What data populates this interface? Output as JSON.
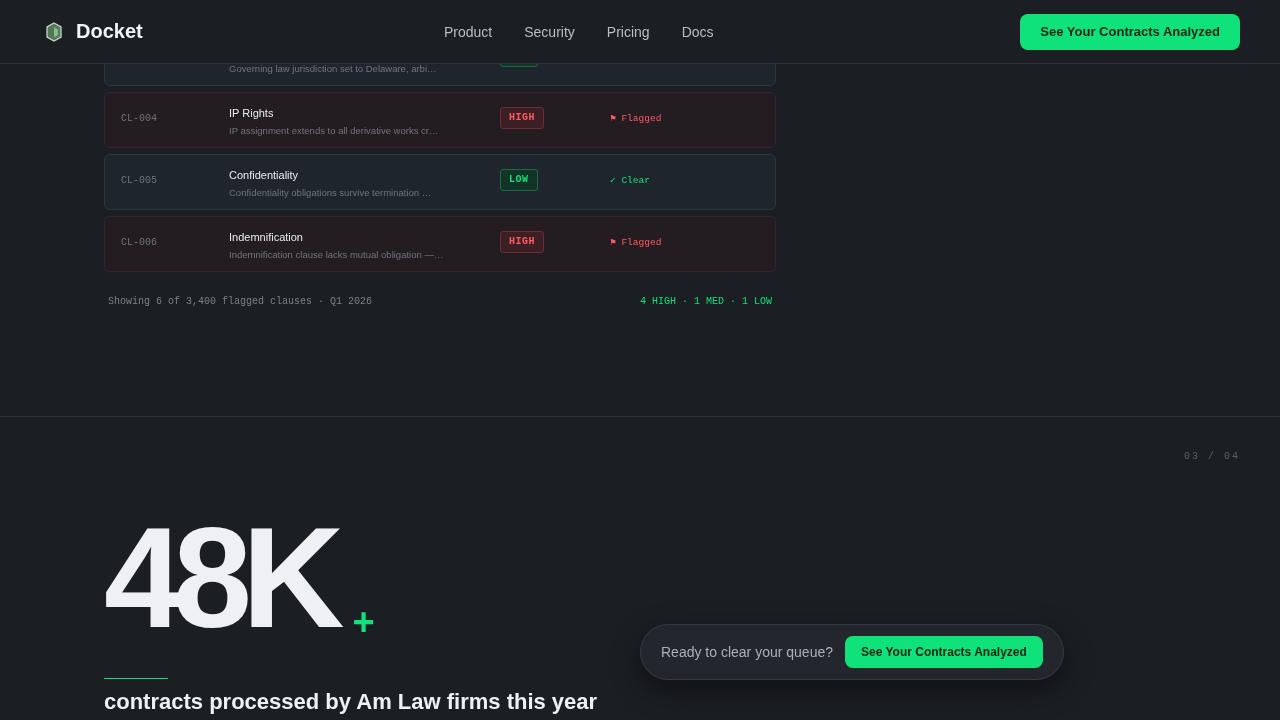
{
  "header": {
    "brand": "Docket",
    "nav": [
      {
        "label": "Product"
      },
      {
        "label": "Security"
      },
      {
        "label": "Pricing"
      },
      {
        "label": "Docs"
      }
    ],
    "cta": "See Your Contracts Analyzed"
  },
  "clauses": [
    {
      "description": "Governing law jurisdiction set to Delaware, arbi…",
      "flagged": false
    },
    {
      "id": "CL-004",
      "title": "IP Rights",
      "description": "IP assignment extends to all derivative works cr…",
      "flagged": true,
      "badge": "HIGH",
      "status": "⚑ Flagged"
    },
    {
      "id": "CL-005",
      "title": "Confidentiality",
      "description": "Confidentiality obligations survive termination …",
      "flagged": false,
      "badge": "LOW",
      "status": "✓ Clear"
    },
    {
      "id": "CL-006",
      "title": "Indemnification",
      "description": "Indemnification clause lacks mutual obligation —…",
      "flagged": true,
      "badge": "HIGH",
      "status": "⚑ Flagged"
    }
  ],
  "table_footer": {
    "summary": "Showing 6 of 3,400 flagged clauses · Q1 2026",
    "counts": "4 HIGH · 1 MED · 1 LOW"
  },
  "stat_section": {
    "page_counter": "03 / 04",
    "value": "48K",
    "suffix": "+",
    "caption": "contracts processed by Am Law firms this year"
  },
  "floating_cta": {
    "prompt": "Ready to clear your queue?",
    "button": "See Your Contracts Analyzed"
  }
}
